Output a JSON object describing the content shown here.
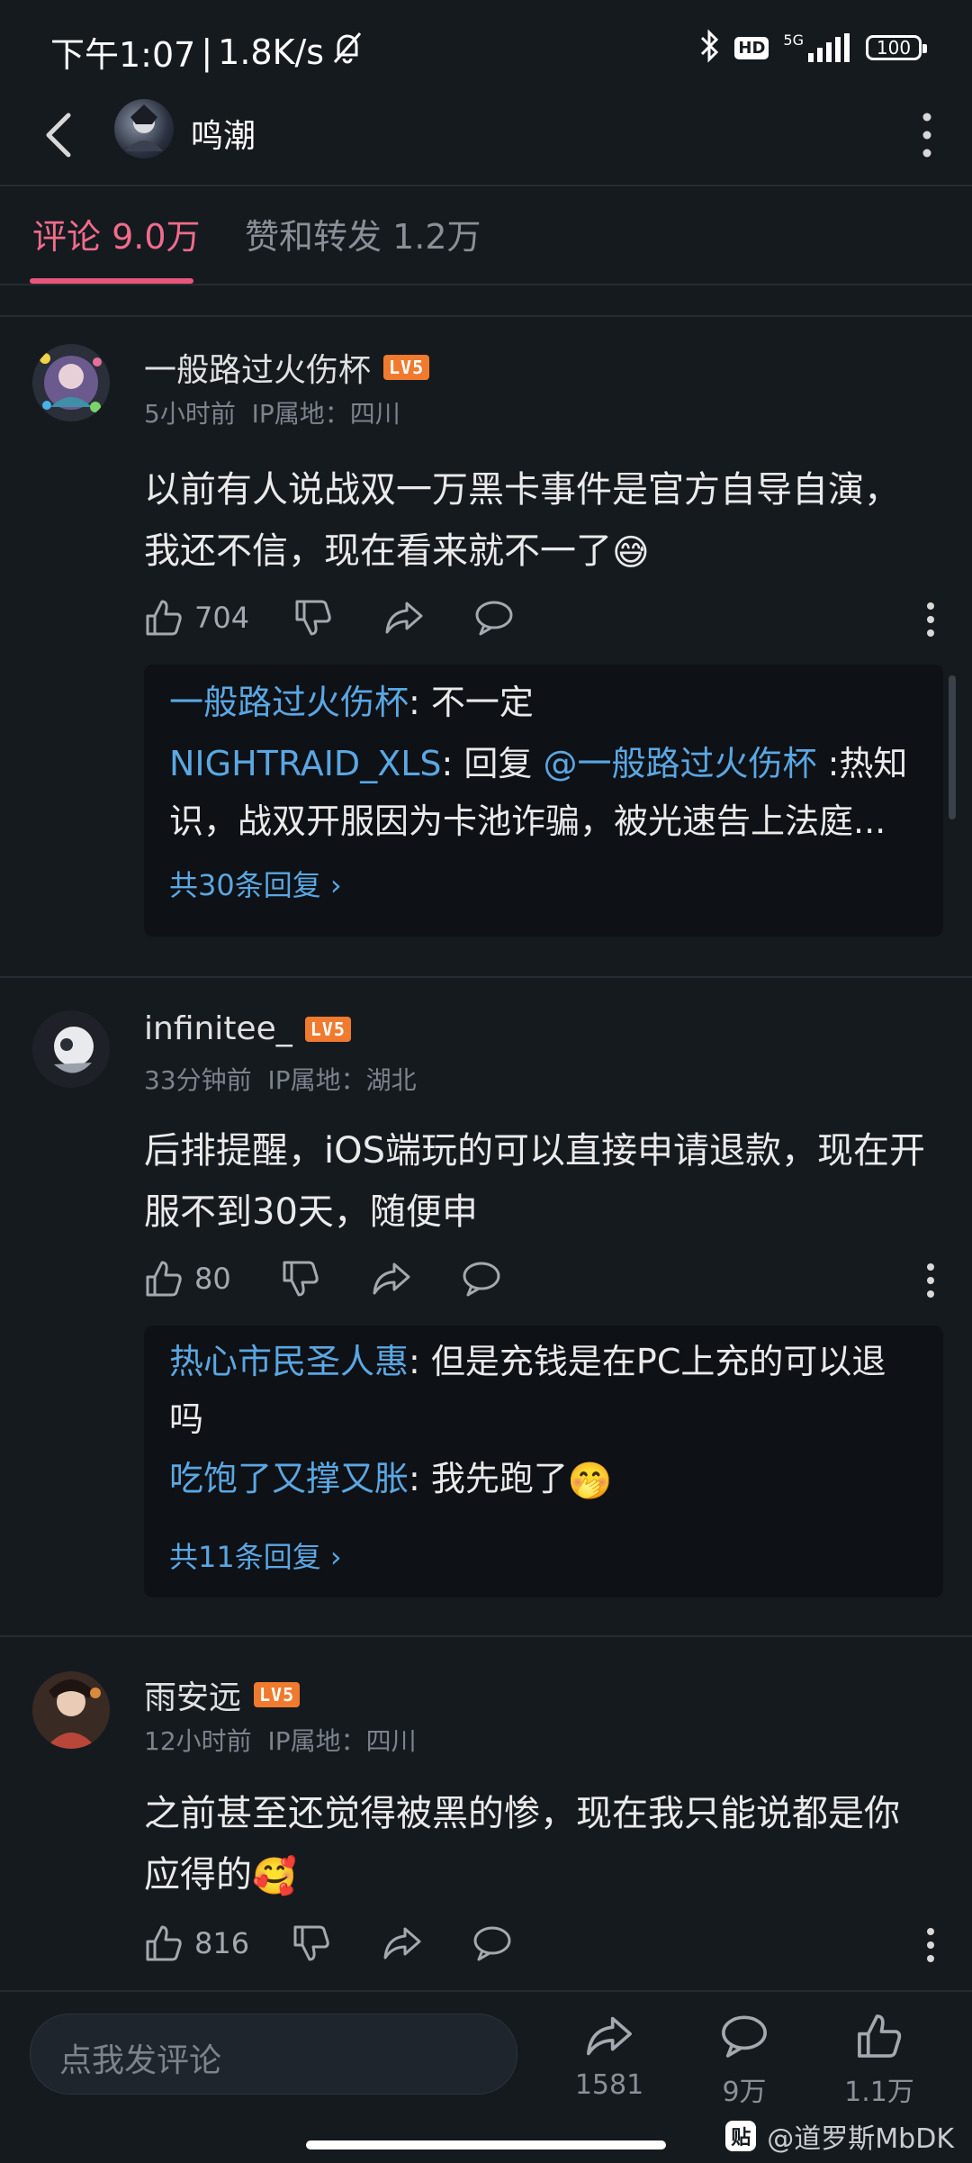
{
  "status_bar": {
    "time": "下午1:07",
    "divider": "|",
    "speed": "1.8K/s",
    "network": "5G",
    "hd": "HD",
    "battery": "100"
  },
  "header": {
    "title": "鸣潮"
  },
  "tabs": [
    {
      "label": "评论 9.0万"
    },
    {
      "label": "赞和转发 1.2万"
    }
  ],
  "comments": [
    {
      "name": "一般路过火伤杯",
      "level": "LV5",
      "time": "5小时前",
      "location": "IP属地：四川",
      "text_line1": "以前有人说战双一万黑卡事件是官方自导自演，",
      "text_line2": "我还不信，现在看来就不一了",
      "likes": "704",
      "replies": [
        {
          "name": "一般路过火伤杯",
          "sep": ": ",
          "text": "不一定"
        },
        {
          "name": "NIGHTRAID_XLS",
          "sep": ": ",
          "prefix": "回复 ",
          "mention": "@一般路过火伤杯",
          "text": " :热知",
          "text_line2": "识，战双开服因为卡池诈骗，被光速告上法庭..."
        }
      ],
      "more_replies": "共30条回复"
    },
    {
      "name": "infinitee_",
      "level": "LV5",
      "time": "33分钟前",
      "location": "IP属地：湖北",
      "text_line1": "后排提醒，iOS端玩的可以直接申请退款，现在开",
      "text_line2": "服不到30天，随便申",
      "likes": "80",
      "replies": [
        {
          "name": "热心市民圣人惠",
          "sep": ": ",
          "text": "但是充钱是在PC上充的可以退",
          "text_line2": "吗"
        },
        {
          "name": "吃饱了又撑又胀",
          "sep": ": ",
          "text": "我先跑了"
        }
      ],
      "more_replies": "共11条回复"
    },
    {
      "name": "雨安远",
      "level": "LV5",
      "time": "12小时前",
      "location": "IP属地：四川",
      "text_line1": "之前甚至还觉得被黑的惨，现在我只能说都是你",
      "text_line2": "应得的",
      "likes": "816"
    }
  ],
  "bottom_bar": {
    "input_placeholder": "点我发评论",
    "share_count": "1581",
    "comment_count": "9万",
    "like_count": "1.1万"
  },
  "watermark": {
    "logo": "贴",
    "text": "@道罗斯MbDK"
  },
  "colors": {
    "background": "#151a1f",
    "accent_tab": "#f06c8c",
    "link_blue": "#5aa7e3",
    "level_badge": "#f07a2e"
  }
}
